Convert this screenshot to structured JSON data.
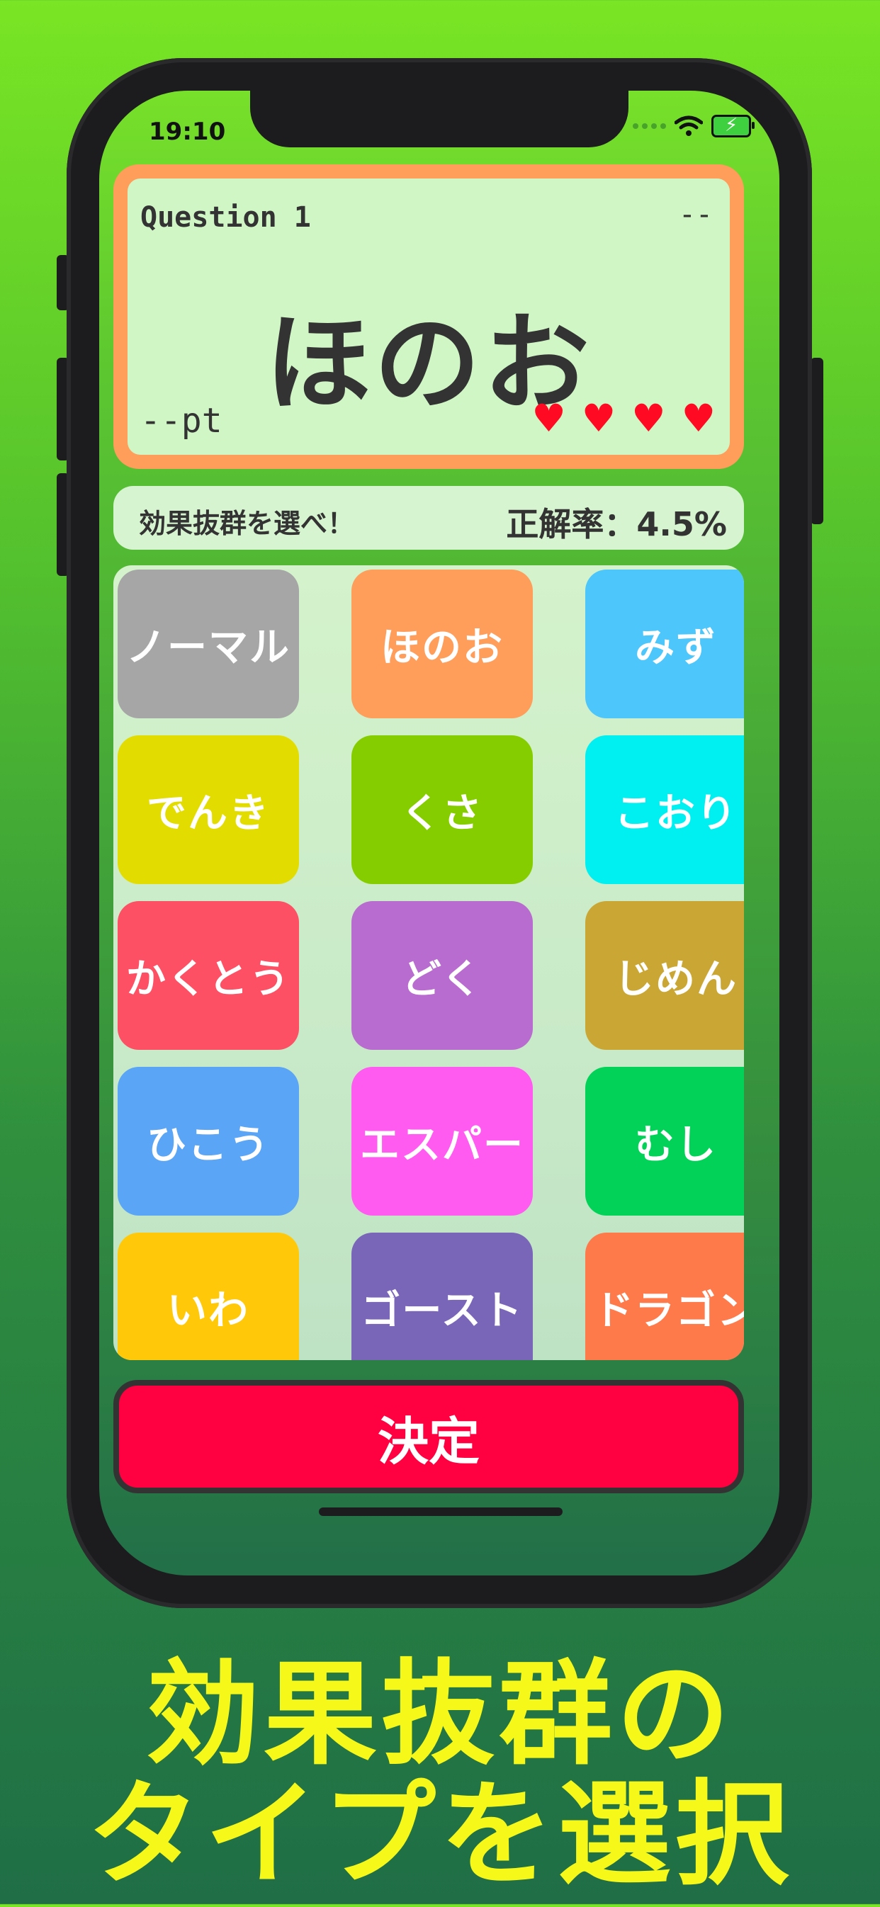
{
  "status": {
    "time": "19:10"
  },
  "question": {
    "label": "Question 1",
    "dash": "--",
    "type": "ほのお",
    "points": "--pt",
    "hearts": [
      "♥",
      "♥",
      "♥",
      "♥"
    ]
  },
  "info": {
    "instruction": "効果抜群を選べ！",
    "accuracy": "正解率：4.5%"
  },
  "types": [
    {
      "label": "ノーマル",
      "color": "#a6a6a6"
    },
    {
      "label": "ほのお",
      "color": "#ff9d5a"
    },
    {
      "label": "みず",
      "color": "#4dc6fb"
    },
    {
      "label": "でんき",
      "color": "#e3dc00"
    },
    {
      "label": "くさ",
      "color": "#86cd00"
    },
    {
      "label": "こおり",
      "color": "#00f0f2"
    },
    {
      "label": "かくとう",
      "color": "#fd5064"
    },
    {
      "label": "どく",
      "color": "#b86ccf"
    },
    {
      "label": "じめん",
      "color": "#caa735"
    },
    {
      "label": "ひこう",
      "color": "#5aa5f5"
    },
    {
      "label": "エスパー",
      "color": "#ff5bf0"
    },
    {
      "label": "むし",
      "color": "#02d358"
    },
    {
      "label": "いわ",
      "color": "#ffc90a"
    },
    {
      "label": "ゴースト",
      "color": "#7a66b9"
    },
    {
      "label": "ドラゴン",
      "color": "#ff7a4a"
    }
  ],
  "decide_label": "決定",
  "caption": {
    "line1": "効果抜群の",
    "line2": "タイプを選択"
  }
}
